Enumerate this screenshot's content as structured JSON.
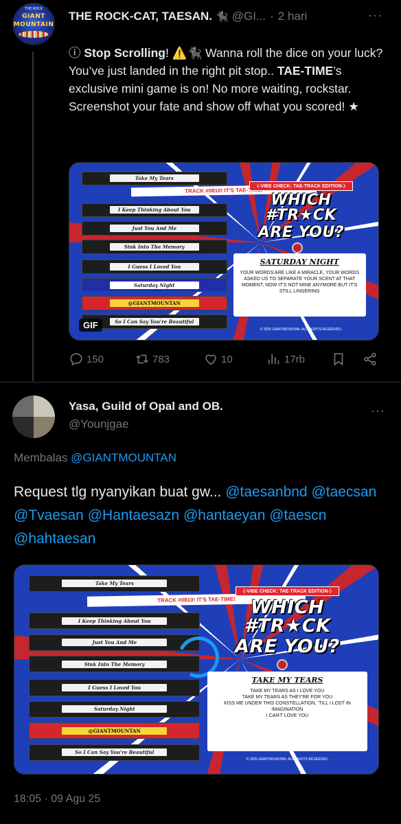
{
  "tweet1": {
    "avatar_text_top": "GIANT",
    "avatar_text_bottom": "MOUNTAIN",
    "avatar_tiny": "THE ROCK",
    "name": "THE ROCK-CAT, TAESAN.",
    "name_emoji": "🐈‍⬛",
    "handle": "@GI...",
    "separator": "·",
    "time": "2 hari",
    "more": "···",
    "text": {
      "p1_icon": "ⓘ",
      "p1_bold": "Stop Scrolling",
      "p1_rest": "! ⚠️🐈‍⬛ Wanna roll the dice on your luck? You’ve just landed in the right pit stop.. ",
      "p2_bold": "TAE-TIME",
      "p2_rest": "’s exclusive mini game is on! No more waiting, rockstar. Screenshot your fate and show off what you scored! ★"
    },
    "media": {
      "tapes": [
        "Take My Tears",
        "I Keep Thinking About You",
        "Just You And Me",
        "Sink Into The Memory",
        "I Guess I Loved You",
        "Saturday Night",
        "@GIANTMOUNTAN",
        "So I Can Say You're Beautiful"
      ],
      "banner": "TRACK #0810! IT'S TAE-TIME!",
      "title_sub": "〈-VIBE CHECK: TAE-TRACK EDITION-〉",
      "title_big_1": "WHICH #TR★CK",
      "title_big_2": "ARE YOU?",
      "card_song": "SATURDAY NIGHT",
      "card_lyric": "YOUR WORDS ARE LIKE A MIRACLE, YOUR WORDS ASKED US TO SEPARATE YOUR SCENT AT THAT MOMENT, NOW IT'S NOT MINE ANYMORE BUT IT'S STILL LINGERING",
      "copyright": "© 2025 GIANTMOUNTAN. ALL RIGHTS RESERVED.",
      "badge": "GIF"
    },
    "actions": {
      "replies": "150",
      "reposts": "783",
      "likes": "10",
      "views": "17rb"
    }
  },
  "tweet2": {
    "name": "Yasa, Guild of Opal and OB.",
    "handle": "@Younjgae",
    "more": "···",
    "reply_prefix": "Membalas ",
    "reply_to": "@GIANTMOUNTAN",
    "text_plain": "Request tlg nyanyikan buat gw... ",
    "mentions": [
      "@taesanbnd",
      "@taecsan",
      "@Tvaesan",
      "@Hantaesazn",
      "@hantaeyan",
      "@taescn",
      "@hahtaesan"
    ],
    "media": {
      "tapes": [
        "Take My Tears",
        "I Keep Thinking About You",
        "Just You And Me",
        "Sink Into The Memory",
        "I Guess I Loved You",
        "Saturday Night",
        "@GIANTMOUNTAN",
        "So I Can Say You're Beautiful"
      ],
      "banner": "TRACK #0810! IT'S TAE-TIME!",
      "title_sub": "〈-VIBE CHECK: TAE-TRACK EDITION-〉",
      "title_big_1": "WHICH #TR★CK",
      "title_big_2": "ARE YOU?",
      "card_song": "TAKE MY TEARS",
      "card_lyric_1": "TAKE MY TEARS AS I LOVE YOU",
      "card_lyric_2": "TAKE MY TEARS AS THEY'RE FOR YOU",
      "card_lyric_3": "KISS ME UNDER THIS CONSTELLATION, 'TILL I LOST IN IMAGINATION",
      "card_lyric_4": "I CAN'T LOVE YOU",
      "copyright": "© 2025 GIANTMOUNTAN. ALL RIGHTS RESERVED."
    },
    "timestamp": "18:05 · 09 Agu 25"
  },
  "colors": {
    "background": "#000000",
    "text": "#e7e9ea",
    "muted": "#71767b",
    "link": "#1d9bf0",
    "divider": "#2f3336"
  }
}
